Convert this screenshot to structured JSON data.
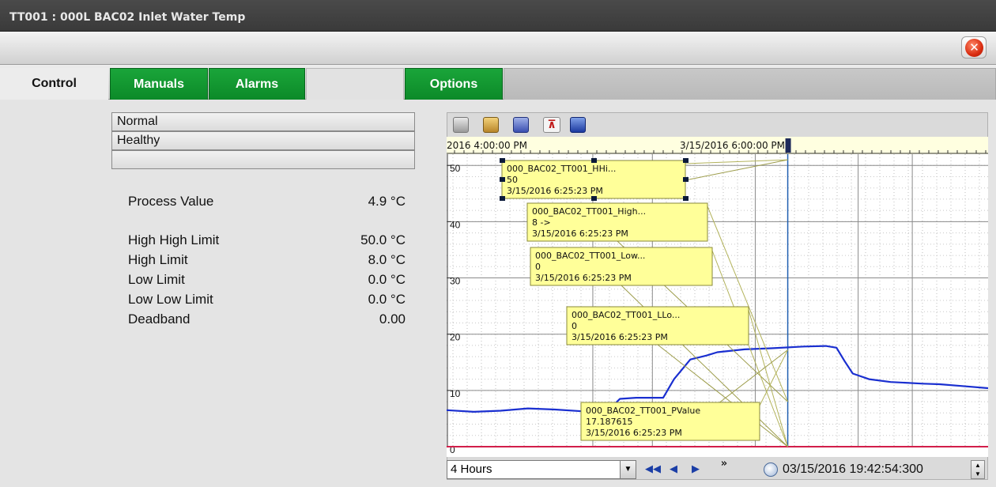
{
  "window": {
    "title": "TT001 : 000L BAC02 Inlet Water Temp"
  },
  "tabs": [
    {
      "label": "Control"
    },
    {
      "label": "Manuals"
    },
    {
      "label": "Alarms"
    },
    {
      "label": ""
    },
    {
      "label": "Options"
    }
  ],
  "status": {
    "line1": "Normal",
    "line2": "Healthy",
    "line3": ""
  },
  "values": [
    {
      "label": "Process Value",
      "value": "4.9 °C"
    },
    {
      "label": "High High Limit",
      "value": "50.0 °C"
    },
    {
      "label": "High Limit",
      "value": "8.0 °C"
    },
    {
      "label": "Low Limit",
      "value": "0.0 °C"
    },
    {
      "label": "Low Low Limit",
      "value": "0.0 °C"
    },
    {
      "label": "Deadband",
      "value": "0.00"
    }
  ],
  "chart_toolbar": {
    "icons": [
      "print-icon",
      "copy-icon",
      "export-icon",
      "cursor-icon",
      "save-icon"
    ]
  },
  "chart_data": {
    "type": "line",
    "title": "",
    "xlabel": "",
    "ylabel": "",
    "top_axis_labels": [
      "2016 4:00:00 PM",
      "3/15/2016 6:00:00 PM"
    ],
    "yticks": [
      "0",
      "10",
      "20",
      "30",
      "40",
      "50"
    ],
    "ylim": [
      0,
      52
    ],
    "grid": true,
    "series": [
      {
        "color": "#1a2fd0",
        "x": [
          0,
          5,
          10,
          15,
          20,
          25,
          30,
          32,
          35,
          40,
          42,
          45,
          48,
          50,
          55,
          60,
          66,
          70,
          72,
          73.5,
          75,
          78,
          82,
          88,
          91,
          95,
          100
        ],
        "y": [
          6.5,
          6.2,
          6.4,
          6.8,
          6.6,
          6.3,
          6.6,
          8.5,
          8.7,
          8.7,
          12.0,
          15.5,
          16.2,
          16.8,
          17.3,
          17.5,
          17.8,
          17.9,
          17.6,
          15.2,
          13.0,
          12.0,
          11.5,
          11.2,
          11.1,
          10.8,
          10.4
        ]
      }
    ],
    "reference_lines": [
      {
        "y": 0,
        "color": "#d21e4a"
      }
    ],
    "cursor_line": {
      "x": 63,
      "color": "#1f5fb0"
    },
    "annotations": [
      {
        "lines": [
          "000_BAC02_TT001_HHi...",
          "50",
          "3/15/2016 6:25:23 PM"
        ]
      },
      {
        "lines": [
          "000_BAC02_TT001_High...",
          "8 ->",
          "3/15/2016 6:25:23 PM"
        ]
      },
      {
        "lines": [
          "000_BAC02_TT001_Low...",
          "0",
          "3/15/2016 6:25:23 PM"
        ]
      },
      {
        "lines": [
          "000_BAC02_TT001_LLo...",
          "0",
          "3/15/2016 6:25:23 PM"
        ]
      },
      {
        "lines": [
          "000_BAC02_TT001_PValue",
          "17.187615",
          "3/15/2016 6:25:23 PM"
        ]
      }
    ]
  },
  "chart_controls": {
    "range": "4 Hours",
    "datetime": "03/15/2016 19:42:54:300"
  },
  "colors": {
    "tab_green": "#0c8a28",
    "trend_line": "#1a2fd0",
    "annotation_bg": "#ffff99",
    "zero_line": "#d21e4a"
  }
}
